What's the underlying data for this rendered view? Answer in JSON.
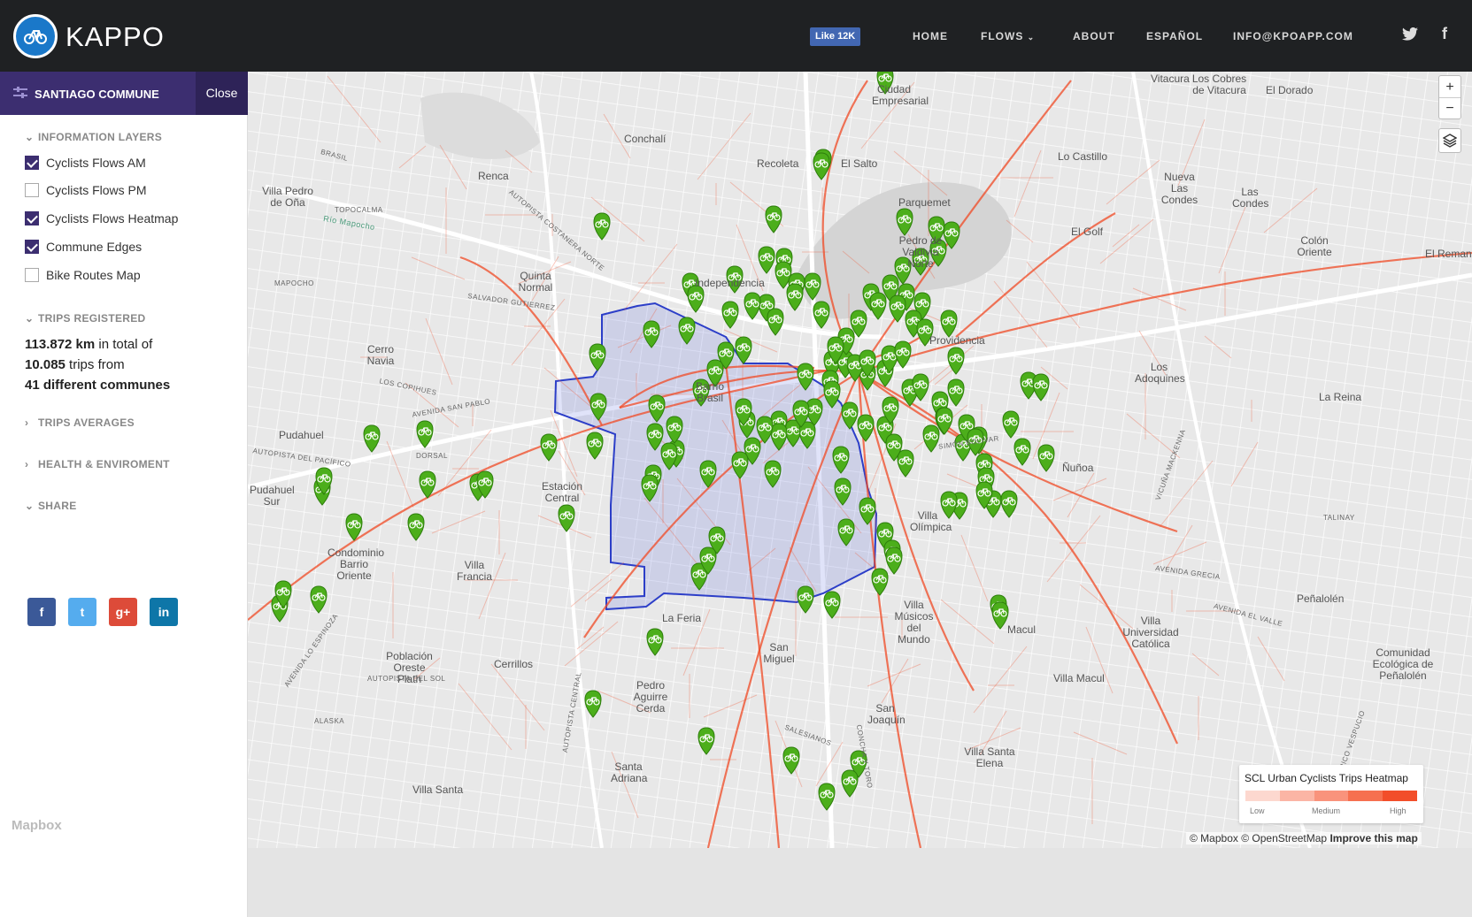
{
  "header": {
    "brand": "KAPPO",
    "fb_like": "Like 12K",
    "nav": [
      "HOME",
      "FLOWS",
      "ABOUT",
      "ESPAÑOL",
      "INFO@KPOAPP.COM"
    ],
    "social": [
      "twitter-icon",
      "facebook-icon"
    ]
  },
  "sidebar": {
    "title": "SANTIAGO COMMUNE",
    "close": "Close",
    "layers_title": "INFORMATION LAYERS",
    "layers": [
      {
        "label": "Cyclists Flows AM",
        "checked": true
      },
      {
        "label": "Cyclists Flows PM",
        "checked": false
      },
      {
        "label": "Cyclists Flows Heatmap",
        "checked": true
      },
      {
        "label": "Commune Edges",
        "checked": true
      },
      {
        "label": "Bike Routes Map",
        "checked": false
      }
    ],
    "trips_title": "TRIPS REGISTERED",
    "stats": {
      "km": "113.872 km",
      "km_suffix": " in total of",
      "trips": "10.085",
      "trips_suffix": " trips from",
      "communes": "41 different communes"
    },
    "averages_title": "TRIPS AVERAGES",
    "health_title": "HEALTH & ENVIROMENT",
    "share_title": "SHARE",
    "share_buttons": [
      {
        "icon": "facebook-icon",
        "glyph": "f",
        "color": "#3b5998"
      },
      {
        "icon": "twitter-icon",
        "glyph": "t",
        "color": "#55acee"
      },
      {
        "icon": "google-plus-icon",
        "glyph": "g+",
        "color": "#dd4b39"
      },
      {
        "icon": "linkedin-icon",
        "glyph": "in",
        "color": "#0e76a8"
      }
    ],
    "mapbox_logo": "Mapbox"
  },
  "map": {
    "zoom_in": "+",
    "zoom_out": "−",
    "places": [
      "Conchalí",
      "Recoleta",
      "El Salto",
      "Renca",
      "Villa Pedro de Oña",
      "Quinta Normal",
      "Independencia",
      "Parquemet",
      "Pedro de Valdivia Norte",
      "Providencia",
      "Cerro Navia",
      "Pudahuel",
      "Barrio Brasil",
      "Estación Central",
      "Lo Castillo",
      "Nueva Las Condes",
      "Las Condes",
      "El Golf",
      "Colón Oriente",
      "El Remanso",
      "Los Adoquines",
      "La Reina",
      "Ñuñoa",
      "Villa Olímpica",
      "Condominio Barrio Oriente",
      "Villa Francia",
      "La Feria",
      "Población Oreste Plath",
      "Cerrillos",
      "Pedro Aguirre Cerda",
      "San Miguel",
      "Villa Músicos del Mundo",
      "Macul",
      "Villa Macul",
      "Villa Universidad Católica",
      "Peñalolén",
      "Comunidad Ecológica de Peñalolén",
      "San Joaquín",
      "Villa Santa Elena",
      "Santa Adriana",
      "Villa Santa",
      "Vitacura",
      "Los Cobres de Vitacura",
      "El Dorado",
      "Pudahuel Sur",
      "Ciudad Empresarial"
    ],
    "streets": [
      "BRASIL",
      "TOPOCALMA",
      "Río Mapocho",
      "AUTOPISTA COSTANERA NORTE",
      "MAPOCHO",
      "SALVADOR GUTIERREZ",
      "LOS COPIHUES",
      "AVENIDA SAN PABLO",
      "AUTOPISTA DEL PACÍFICO",
      "DORSAL",
      "AVENIDA GRECIA",
      "AVENIDA EL VALLE",
      "AUTOPISTA DEL SOL",
      "SALESIANOS",
      "TALINAY",
      "ALASKA",
      "AVENIDA LO ESPINOZA",
      "AMERICO VESPUCIO",
      "AUTOPISTA CENTRAL",
      "VICUÑA MACKENNA",
      "CONCHA Y TORO",
      "SIMÓN BOLIVAR"
    ],
    "legend": {
      "title": "SCL Urban Cyclists Trips Heatmap",
      "low": "Low",
      "medium": "Medium",
      "high": "High",
      "colors": [
        "#fdd8cf",
        "#fbb5a5",
        "#f9937c",
        "#f6704f",
        "#f24e2a"
      ]
    },
    "attribution": {
      "mapbox": "© Mapbox",
      "osm": "© OpenStreetMap",
      "improve": "Improve this map"
    },
    "route_color": "#f04a24",
    "marker_color": "#4cae1b",
    "commune_color": "#2c3ec8"
  }
}
